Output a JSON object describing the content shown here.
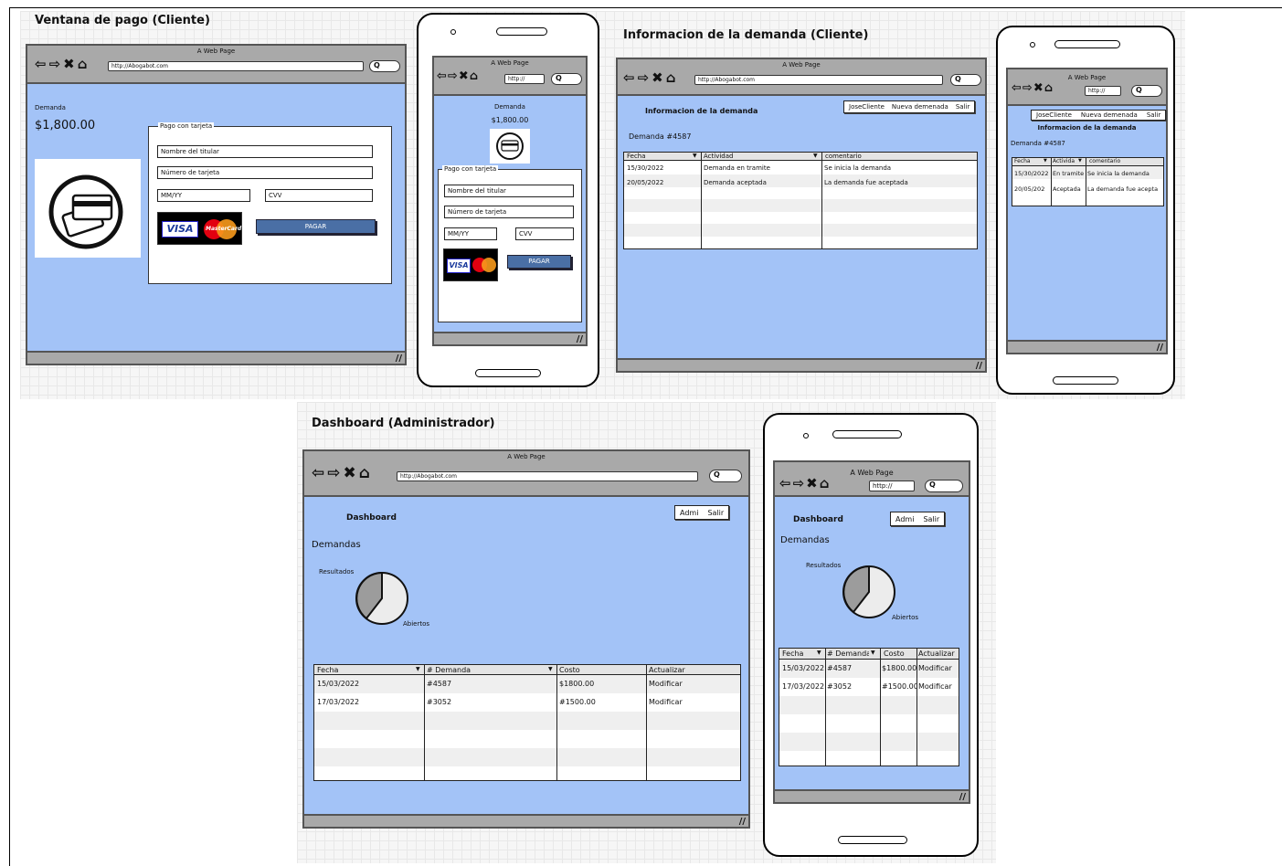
{
  "frames": {
    "pago_title": "Ventana de pago (Cliente)",
    "info_title": "Informacion de la demanda (Cliente)",
    "dash_title": "Dashboard (Administrador)"
  },
  "browser": {
    "window_title": "A Web Page",
    "url": "http://Abogabot.com",
    "url_short": "http://",
    "search_glyph": "Q"
  },
  "pago": {
    "demanda_label": "Demanda",
    "amount": "$1,800.00",
    "panel_legend": "Pago con tarjeta",
    "nombre_placeholder": "Nombre del titular",
    "numero_placeholder": "Número de tarjeta",
    "mmyy_placeholder": "MM/YY",
    "cvv_placeholder": "CVV",
    "pay_button": "PAGAR",
    "visa": "VISA",
    "mastercard": "MasterCard"
  },
  "info": {
    "heading": "Informacion de la demanda",
    "menu": [
      "JoseCliente",
      "Nueva demenada",
      "Salir"
    ],
    "demanda_id": "Demanda #4587",
    "columns": [
      "Fecha",
      "Actividad",
      "comentario"
    ],
    "rows": [
      [
        "15/30/2022",
        "Demanda en tramite",
        "Se inicia la demanda"
      ],
      [
        "20/05/2022",
        "Demanda aceptada",
        "La demanda fue aceptada"
      ]
    ],
    "mobile_columns": [
      "Fecha",
      "Activida",
      "comentario"
    ],
    "mobile_rows": [
      [
        "15/30/2022",
        "En tramite",
        "Se inicia la demanda"
      ],
      [
        "20/05/202",
        "Aceptada",
        "La demanda fue acepta"
      ]
    ]
  },
  "dash": {
    "heading": "Dashboard",
    "menu": [
      "Admi",
      "Salir"
    ],
    "demandas_label": "Demandas",
    "pie_label_resultados": "Resultados",
    "pie_label_abiertos": "Abiertos",
    "columns": [
      "Fecha",
      "# Demanda",
      "Costo",
      "Actualizar"
    ],
    "rows": [
      [
        "15/03/2022",
        "#4587",
        "$1800.00",
        "Modificar"
      ],
      [
        "17/03/2022",
        "#3052",
        "#1500.00",
        "Modificar"
      ]
    ],
    "mobile_columns": [
      "Fecha",
      "# Demanda",
      "Costo",
      "Actualizar"
    ],
    "mobile_rows": [
      [
        "15/03/2022",
        "#4587",
        "$1800.00",
        "Modificar"
      ],
      [
        "17/03/2022",
        "#3052",
        "#1500.00",
        "Modificar"
      ]
    ]
  },
  "colors": {
    "content_blue": "#a3c3f7",
    "chrome_gray": "#a9a9a9",
    "button_blue": "#4a6fa5"
  },
  "icons": [
    "back-arrow-icon",
    "forward-arrow-icon",
    "close-x-icon",
    "home-icon",
    "search-icon",
    "credit-card-icon",
    "dropdown-arrow-icon",
    "resize-grip-icon"
  ]
}
